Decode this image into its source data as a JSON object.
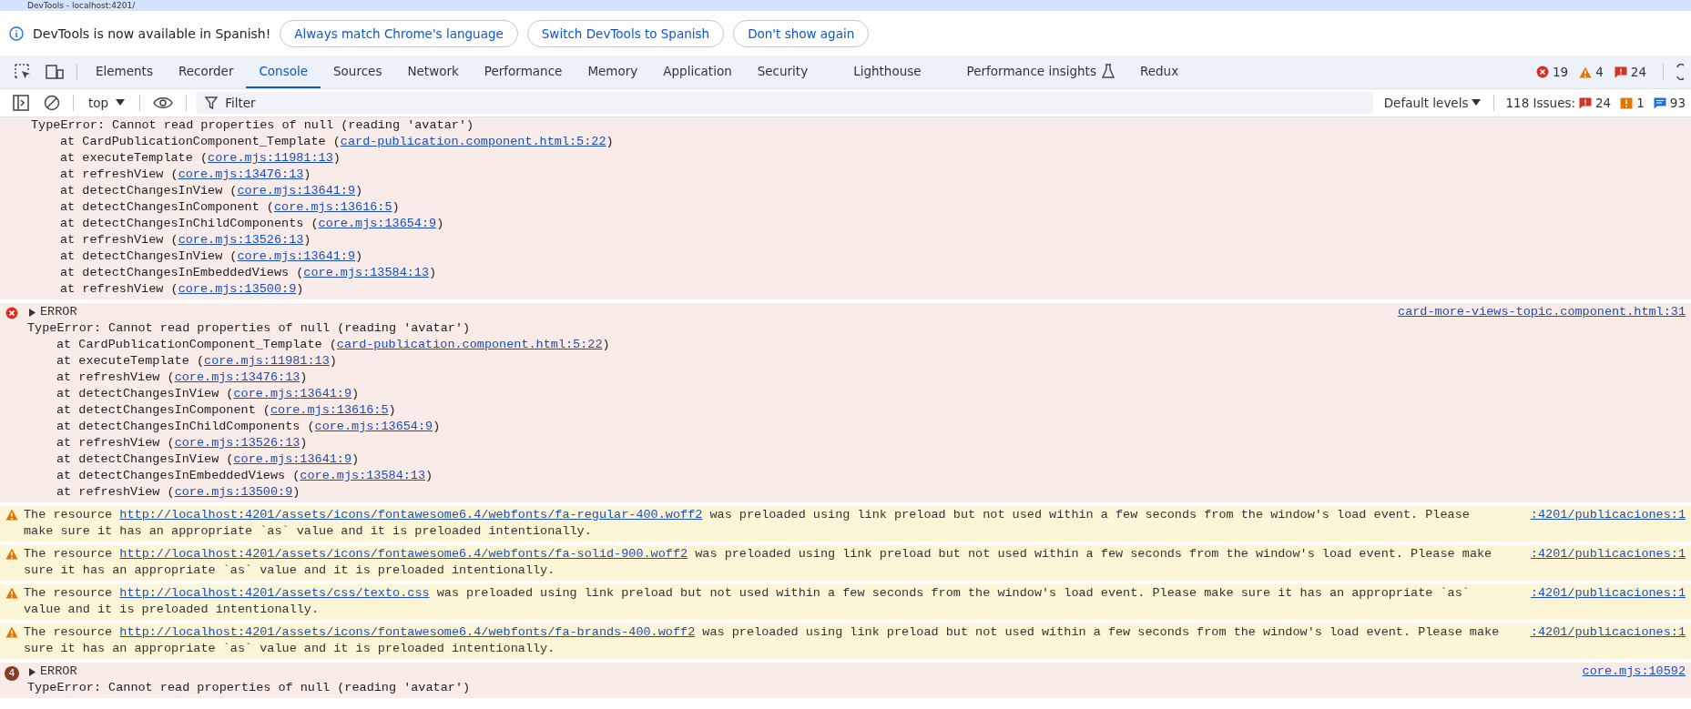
{
  "window": {
    "title": "DevTools - localhost:4201/"
  },
  "infobar": {
    "message": "DevTools is now available in Spanish!",
    "buttons": [
      "Always match Chrome's language",
      "Switch DevTools to Spanish",
      "Don't show again"
    ]
  },
  "tabs": [
    {
      "label": "Elements",
      "selected": false
    },
    {
      "label": "Recorder",
      "selected": false
    },
    {
      "label": "Console",
      "selected": true
    },
    {
      "label": "Sources",
      "selected": false
    },
    {
      "label": "Network",
      "selected": false
    },
    {
      "label": "Performance",
      "selected": false
    },
    {
      "label": "Memory",
      "selected": false
    },
    {
      "label": "Application",
      "selected": false
    },
    {
      "label": "Security",
      "selected": false
    },
    {
      "label": "Lighthouse",
      "selected": false
    },
    {
      "label": "Performance insights",
      "selected": false,
      "experimental": true
    },
    {
      "label": "Redux",
      "selected": false
    }
  ],
  "counters": [
    {
      "kind": "error",
      "count": "19"
    },
    {
      "kind": "warning",
      "count": "4"
    },
    {
      "kind": "issue",
      "count": "24"
    }
  ],
  "toolbar": {
    "context": "top",
    "filter_placeholder": "Filter",
    "levels": "Default levels",
    "issues_label": "118 Issues:",
    "issue_counts": [
      {
        "kind": "issue",
        "count": "24"
      },
      {
        "kind": "warning",
        "count": "1"
      },
      {
        "kind": "info",
        "count": "93"
      }
    ]
  },
  "messages": [
    {
      "kind": "error",
      "continued": true,
      "text": "TypeError: Cannot read properties of null (reading 'avatar')",
      "frames": [
        {
          "call": "at CardPublicationComponent_Template (",
          "loc": "card-publication.component.html:5:22",
          "close": ")"
        },
        {
          "call": "at executeTemplate (",
          "loc": "core.mjs:11981:13",
          "close": ")"
        },
        {
          "call": "at refreshView (",
          "loc": "core.mjs:13476:13",
          "close": ")"
        },
        {
          "call": "at detectChangesInView (",
          "loc": "core.mjs:13641:9",
          "close": ")"
        },
        {
          "call": "at detectChangesInComponent (",
          "loc": "core.mjs:13616:5",
          "close": ")"
        },
        {
          "call": "at detectChangesInChildComponents (",
          "loc": "core.mjs:13654:9",
          "close": ")"
        },
        {
          "call": "at refreshView (",
          "loc": "core.mjs:13526:13",
          "close": ")"
        },
        {
          "call": "at detectChangesInView (",
          "loc": "core.mjs:13641:9",
          "close": ")"
        },
        {
          "call": "at detectChangesInEmbeddedViews (",
          "loc": "core.mjs:13584:13",
          "close": ")"
        },
        {
          "call": "at refreshView (",
          "loc": "core.mjs:13500:9",
          "close": ")"
        }
      ]
    },
    {
      "kind": "error",
      "header": "ERROR",
      "expanded": false,
      "source": "card-more-views-topic.component.html:31",
      "text": "TypeError: Cannot read properties of null (reading 'avatar')",
      "frames": [
        {
          "call": "at CardPublicationComponent_Template (",
          "loc": "card-publication.component.html:5:22",
          "close": ")"
        },
        {
          "call": "at executeTemplate (",
          "loc": "core.mjs:11981:13",
          "close": ")"
        },
        {
          "call": "at refreshView (",
          "loc": "core.mjs:13476:13",
          "close": ")"
        },
        {
          "call": "at detectChangesInView (",
          "loc": "core.mjs:13641:9",
          "close": ")"
        },
        {
          "call": "at detectChangesInComponent (",
          "loc": "core.mjs:13616:5",
          "close": ")"
        },
        {
          "call": "at detectChangesInChildComponents (",
          "loc": "core.mjs:13654:9",
          "close": ")"
        },
        {
          "call": "at refreshView (",
          "loc": "core.mjs:13526:13",
          "close": ")"
        },
        {
          "call": "at detectChangesInView (",
          "loc": "core.mjs:13641:9",
          "close": ")"
        },
        {
          "call": "at detectChangesInEmbeddedViews (",
          "loc": "core.mjs:13584:13",
          "close": ")"
        },
        {
          "call": "at refreshView (",
          "loc": "core.mjs:13500:9",
          "close": ")"
        }
      ]
    },
    {
      "kind": "warning",
      "before": "The resource ",
      "url": "http://localhost:4201/assets/icons/fontawesome6.4/webfonts/fa-regular-400.woff2",
      "after": " was preloaded using link preload but not used within a few seconds from the window's load event. Please make sure it has an appropriate `as` value and it is preloaded intentionally.",
      "source": ":4201/publicaciones:1"
    },
    {
      "kind": "warning",
      "before": "The resource ",
      "url": "http://localhost:4201/assets/icons/fontawesome6.4/webfonts/fa-solid-900.woff2",
      "after": " was preloaded using link preload but not used within a few seconds from the window's load event. Please make sure it has an appropriate `as` value and it is preloaded intentionally.",
      "source": ":4201/publicaciones:1"
    },
    {
      "kind": "warning",
      "before": "The resource ",
      "url": "http://localhost:4201/assets/css/texto.css",
      "after": " was preloaded using link preload but not used within a few seconds from the window's load event. Please make sure it has an appropriate `as` value and it is preloaded intentionally.",
      "source": ":4201/publicaciones:1"
    },
    {
      "kind": "warning",
      "before": "The resource ",
      "url": "http://localhost:4201/assets/icons/fontawesome6.4/webfonts/fa-brands-400.woff2",
      "after": " was preloaded using link preload but not used within a few seconds from the window's load event. Please make sure it has an appropriate `as` value and it is preloaded intentionally.",
      "source": ":4201/publicaciones:1"
    },
    {
      "kind": "error",
      "repeat": "4",
      "header": "ERROR",
      "expanded": false,
      "source": "core.mjs:10592",
      "text": "TypeError: Cannot read properties of null (reading 'avatar')"
    }
  ]
}
